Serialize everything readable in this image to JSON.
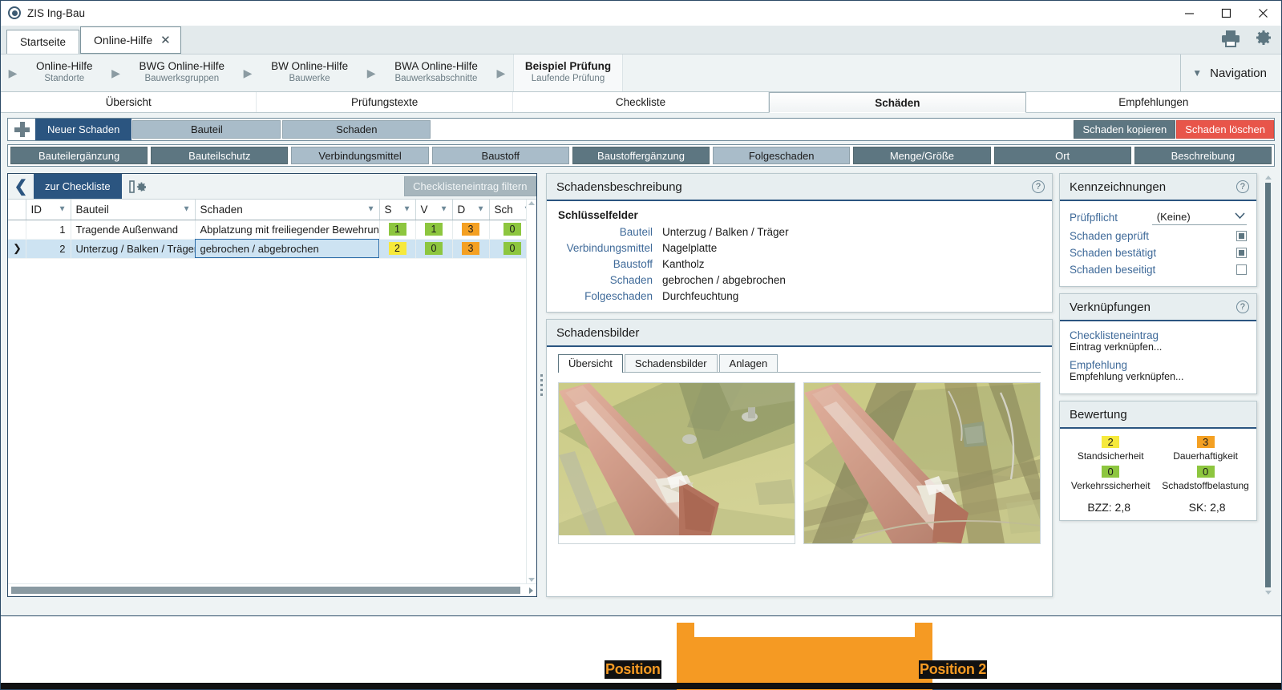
{
  "window": {
    "title": "ZIS Ing-Bau",
    "logo_icon": "app-logo-icon",
    "minimize_icon": "minimize-icon",
    "maximize_icon": "maximize-icon",
    "close_icon": "close-icon"
  },
  "tabs": [
    {
      "label": "Startseite",
      "active": false,
      "closable": false
    },
    {
      "label": "Online-Hilfe",
      "active": true,
      "closable": true,
      "close_glyph": "✕"
    }
  ],
  "header_icons": [
    {
      "name": "print-icon"
    },
    {
      "name": "settings-gear-icon"
    }
  ],
  "breadcrumb": {
    "arrow_glyph": "▶",
    "items": [
      {
        "title": "Online-Hilfe",
        "subtitle": "Standorte",
        "current": false
      },
      {
        "title": "BWG Online-Hilfe",
        "subtitle": "Bauwerksgruppen",
        "current": false
      },
      {
        "title": "BW Online-Hilfe",
        "subtitle": "Bauwerke",
        "current": false
      },
      {
        "title": "BWA Online-Hilfe",
        "subtitle": "Bauwerksabschnitte",
        "current": false
      },
      {
        "title": "Beispiel Prüfung",
        "subtitle": "Laufende Prüfung",
        "current": true
      }
    ],
    "navigation_label": "Navigation",
    "navigation_caret": "▼"
  },
  "main_tabs": [
    {
      "label": "Übersicht",
      "active": false
    },
    {
      "label": "Prüfungstexte",
      "active": false
    },
    {
      "label": "Checkliste",
      "active": false
    },
    {
      "label": "Schäden",
      "active": true
    },
    {
      "label": "Empfehlungen",
      "active": false
    }
  ],
  "toolbar": {
    "add_icon": "plus-icon",
    "new_damage_label": "Neuer Schaden",
    "chips": [
      {
        "label": "Bauteil"
      },
      {
        "label": "Schaden"
      }
    ],
    "copy_label": "Schaden kopieren",
    "delete_label": "Schaden löschen",
    "second_row": [
      {
        "label": "Bauteilergänzung",
        "style": "dark"
      },
      {
        "label": "Bauteilschutz",
        "style": "dark"
      },
      {
        "label": "Verbindungsmittel",
        "style": "light"
      },
      {
        "label": "Baustoff",
        "style": "light"
      },
      {
        "label": "Baustoffergänzung",
        "style": "dark"
      },
      {
        "label": "Folgeschaden",
        "style": "light"
      },
      {
        "label": "Menge/Größe",
        "style": "dark"
      },
      {
        "label": "Ort",
        "style": "dark"
      },
      {
        "label": "Beschreibung",
        "style": "dark"
      }
    ]
  },
  "left_panel": {
    "back_glyph": "❮",
    "back_label": "zur Checkliste",
    "gear_icon": "column-settings-gear-icon",
    "filter_button_label": "Checklisteneintrag filtern",
    "columns": [
      {
        "label": "ID"
      },
      {
        "label": "Bauteil"
      },
      {
        "label": "Schaden"
      },
      {
        "label": "S"
      },
      {
        "label": "V"
      },
      {
        "label": "D"
      },
      {
        "label": "Sch"
      }
    ],
    "filter_glyph": "▼",
    "rows": [
      {
        "id": "1",
        "bauteil": "Tragende Außenwand",
        "schaden": "Abplatzung mit freiliegender Bewehrung",
        "s": "1",
        "s_color": "g",
        "v": "1",
        "v_color": "g",
        "d": "3",
        "d_color": "o",
        "sch": "0",
        "sch_color": "g",
        "selected": false
      },
      {
        "id": "2",
        "bauteil": "Unterzug / Balken / Träger",
        "schaden": "gebrochen / abgebrochen",
        "s": "2",
        "s_color": "y",
        "v": "0",
        "v_color": "g",
        "d": "3",
        "d_color": "o",
        "sch": "0",
        "sch_color": "g",
        "selected": true
      }
    ]
  },
  "damage_description": {
    "title": "Schadensbeschreibung",
    "help_glyph": "?",
    "section_label": "Schlüsselfelder",
    "fields": [
      {
        "key": "Bauteil",
        "value": "Unterzug / Balken / Träger"
      },
      {
        "key": "Verbindungsmittel",
        "value": "Nagelplatte"
      },
      {
        "key": "Baustoff",
        "value": "Kantholz"
      },
      {
        "key": "Schaden",
        "value": "gebrochen / abgebrochen"
      },
      {
        "key": "Folgeschaden",
        "value": "Durchfeuchtung"
      }
    ]
  },
  "damage_images": {
    "title": "Schadensbilder",
    "tabs": [
      {
        "label": "Übersicht",
        "active": true
      },
      {
        "label": "Schadensbilder",
        "active": false
      },
      {
        "label": "Anlagen",
        "active": false
      }
    ],
    "thumbnails": [
      {
        "name": "damage-photo-1"
      },
      {
        "name": "damage-photo-2"
      }
    ]
  },
  "markings": {
    "title": "Kennzeichnungen",
    "help_glyph": "?",
    "pruefpflicht_label": "Prüfpflicht",
    "pruefpflicht_value": "(Keine)",
    "dropdown_glyph": "⌄",
    "checkboxes": [
      {
        "label": "Schaden geprüft",
        "checked": true
      },
      {
        "label": "Schaden bestätigt",
        "checked": true
      },
      {
        "label": "Schaden beseitigt",
        "checked": false
      }
    ]
  },
  "links_panel": {
    "title": "Verknüpfungen",
    "help_glyph": "?",
    "entries": [
      {
        "link": "Checklisteneintrag",
        "sub": "Eintrag verknüpfen..."
      },
      {
        "link": "Empfehlung",
        "sub": "Empfehlung verknüpfen..."
      }
    ]
  },
  "rating": {
    "title": "Bewertung",
    "items": [
      {
        "value": "2",
        "color": "y",
        "label": "Standsicherheit"
      },
      {
        "value": "3",
        "color": "o",
        "label": "Dauerhaftigkeit"
      },
      {
        "value": "0",
        "color": "g",
        "label": "Verkehrssicherheit"
      },
      {
        "value": "0",
        "color": "g",
        "label": "Schadstoffbelastung"
      }
    ],
    "totals": [
      {
        "label": "BZZ: 2,8"
      },
      {
        "label": "SK: 2,8"
      }
    ]
  },
  "annotation_overlay": {
    "position_1_label": "Position",
    "position_2_label": "Position 2",
    "highlight_color": "#f59a23"
  },
  "colors": {
    "accent_blue": "#2b5580",
    "danger_red": "#e8554a",
    "toolbar_dark": "#5d7681",
    "toolbar_light": "#a9bcc9",
    "badge_green": "#8dc63f",
    "badge_yellow": "#f6e93c",
    "badge_orange": "#f4a022",
    "selection_blue": "#cde3f2"
  }
}
